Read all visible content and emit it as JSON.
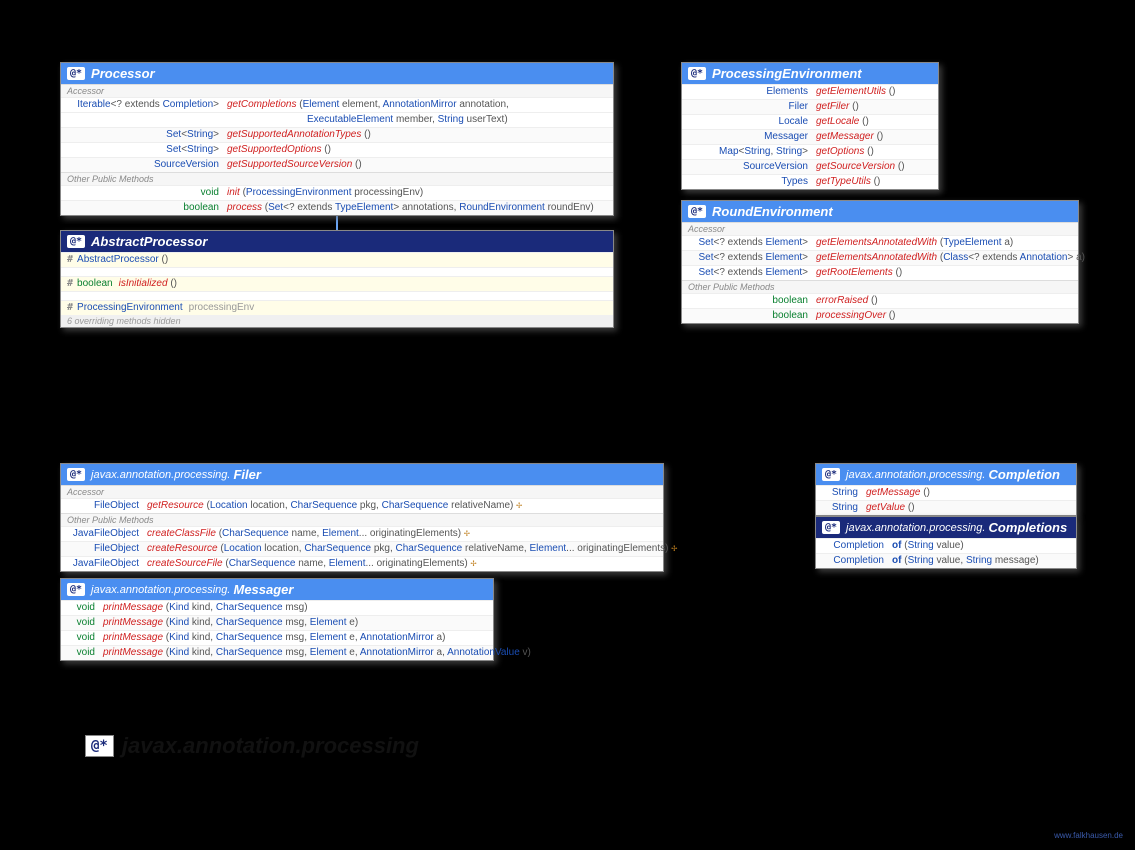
{
  "badge": "@*",
  "processor": {
    "title": "Processor",
    "sec1": "Accessor",
    "r1_ret": "Iterable<? extends Completion>",
    "r1_sig": "getCompletions (Element element, AnnotationMirror annotation,",
    "r1b_sig": "ExecutableElement member, String userText)",
    "r2_ret": "Set<String>",
    "r2_sig": "getSupportedAnnotationTypes ()",
    "r3_ret": "Set<String>",
    "r3_sig": "getSupportedOptions ()",
    "r4_ret": "SourceVersion",
    "r4_sig": "getSupportedSourceVersion ()",
    "sec2": "Other Public Methods",
    "r5_ret": "void",
    "r5_sig": "init (ProcessingEnvironment processingEnv)",
    "r6_ret": "boolean",
    "r6_sig": "process (Set<? extends TypeElement> annotations, RoundEnvironment roundEnv)"
  },
  "abstractProcessor": {
    "title": "AbstractProcessor",
    "r1": "AbstractProcessor ()",
    "r2_ret": "boolean",
    "r2_sig": "isInitialized ()",
    "r3_ret": "ProcessingEnvironment",
    "r3_sig": "processingEnv",
    "hidden": "6 overriding methods hidden"
  },
  "procEnv": {
    "title": "ProcessingEnvironment",
    "r1_ret": "Elements",
    "r1_sig": "getElementUtils ()",
    "r2_ret": "Filer",
    "r2_sig": "getFiler ()",
    "r3_ret": "Locale",
    "r3_sig": "getLocale ()",
    "r4_ret": "Messager",
    "r4_sig": "getMessager ()",
    "r5_ret": "Map<String, String>",
    "r5_sig": "getOptions ()",
    "r6_ret": "SourceVersion",
    "r6_sig": "getSourceVersion ()",
    "r7_ret": "Types",
    "r7_sig": "getTypeUtils ()"
  },
  "roundEnv": {
    "title": "RoundEnvironment",
    "sec1": "Accessor",
    "r1_ret": "Set<? extends Element>",
    "r1_sig": "getElementsAnnotatedWith (TypeElement a)",
    "r2_ret": "Set<? extends Element>",
    "r2_sig": "getElementsAnnotatedWith (Class<? extends Annotation> a)",
    "r3_ret": "Set<? extends Element>",
    "r3_sig": "getRootElements ()",
    "sec2": "Other Public Methods",
    "r4_ret": "boolean",
    "r4_sig": "errorRaised ()",
    "r5_ret": "boolean",
    "r5_sig": "processingOver ()"
  },
  "filer": {
    "pkg": "javax.annotation.processing.",
    "title": "Filer",
    "sec1": "Accessor",
    "r1_ret": "FileObject",
    "r1_sig": "getResource (Location location, CharSequence pkg, CharSequence relativeName) ",
    "sec2": "Other Public Methods",
    "r2_ret": "JavaFileObject",
    "r2_sig": "createClassFile (CharSequence name, Element... originatingElements) ",
    "r3_ret": "FileObject",
    "r3_sig": "createResource (Location location, CharSequence pkg, CharSequence relativeName, Element... originatingElements) ",
    "r4_ret": "JavaFileObject",
    "r4_sig": "createSourceFile (CharSequence name, Element... originatingElements) "
  },
  "messager": {
    "pkg": "javax.annotation.processing.",
    "title": "Messager",
    "r1_ret": "void",
    "r1_sig": "printMessage (Kind kind, CharSequence msg)",
    "r2_ret": "void",
    "r2_sig": "printMessage (Kind kind, CharSequence msg, Element e)",
    "r3_ret": "void",
    "r3_sig": "printMessage (Kind kind, CharSequence msg, Element e, AnnotationMirror a)",
    "r4_ret": "void",
    "r4_sig": "printMessage (Kind kind, CharSequence msg, Element e, AnnotationMirror a, AnnotationValue v)"
  },
  "completion": {
    "pkg": "javax.annotation.processing.",
    "title": "Completion",
    "r1_ret": "String",
    "r1_sig": "getMessage ()",
    "r2_ret": "String",
    "r2_sig": "getValue ()"
  },
  "completions": {
    "pkg": "javax.annotation.processing.",
    "title": "Completions",
    "r1_ret": "Completion",
    "r1_sig": "of (String value)",
    "r2_ret": "Completion",
    "r2_sig": "of (String value, String message)"
  },
  "footer": "javax.annotation.processing",
  "watermark": "www.falkhausen.de",
  "throwsMark": "✢"
}
